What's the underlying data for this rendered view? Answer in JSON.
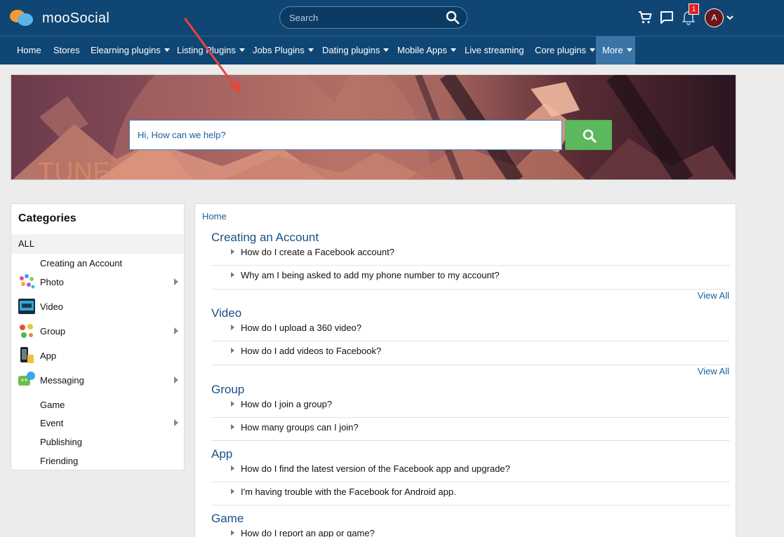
{
  "header": {
    "brand": "mooSocial",
    "search_placeholder": "Search",
    "notification_count": "1",
    "avatar_initial": "A"
  },
  "nav": {
    "items": [
      {
        "label": "Home",
        "has_dropdown": false
      },
      {
        "label": "Stores",
        "has_dropdown": false
      },
      {
        "label": "Elearning plugins",
        "has_dropdown": true
      },
      {
        "label": "Listing Plugins",
        "has_dropdown": true
      },
      {
        "label": "Jobs Plugins",
        "has_dropdown": true
      },
      {
        "label": "Dating plugins",
        "has_dropdown": true
      },
      {
        "label": "Mobile Apps",
        "has_dropdown": true
      },
      {
        "label": "Live streaming",
        "has_dropdown": false
      },
      {
        "label": "Core plugins",
        "has_dropdown": true
      },
      {
        "label": "More",
        "has_dropdown": true,
        "active": true
      }
    ]
  },
  "hero": {
    "search_placeholder": "Hi, How can we help?",
    "banner_text": "TUNE"
  },
  "sidebar": {
    "title": "Categories",
    "all_label": "ALL",
    "items": [
      {
        "label": "Creating an Account",
        "icon": "",
        "has_children": false
      },
      {
        "label": "Photo",
        "icon": "photo-icon",
        "has_children": true
      },
      {
        "label": "Video",
        "icon": "video-icon",
        "has_children": false
      },
      {
        "label": "Group",
        "icon": "group-icon",
        "has_children": true
      },
      {
        "label": "App",
        "icon": "app-icon",
        "has_children": false
      },
      {
        "label": "Messaging",
        "icon": "messaging-icon",
        "has_children": true
      },
      {
        "label": "Game",
        "icon": "",
        "has_children": false
      },
      {
        "label": "Event",
        "icon": "",
        "has_children": true
      },
      {
        "label": "Publishing",
        "icon": "",
        "has_children": false
      },
      {
        "label": "Friending",
        "icon": "",
        "has_children": false
      }
    ]
  },
  "main": {
    "breadcrumb": "Home",
    "view_all_label": "View All",
    "sections": [
      {
        "title": "Creating an Account",
        "questions": [
          "How do I create a Facebook account?",
          "Why am I being asked to add my phone number to my account?"
        ],
        "view_all": true
      },
      {
        "title": "Video",
        "questions": [
          "How do I upload a 360 video?",
          "How do I add videos to Facebook?"
        ],
        "view_all": true
      },
      {
        "title": "Group",
        "questions": [
          "How do I join a group?",
          "How many groups can I join?"
        ],
        "view_all": false
      },
      {
        "title": "App",
        "questions": [
          "How do I find the latest version of the Facebook app and upgrade?",
          "I'm having trouble with the Facebook for Android app."
        ],
        "view_all": false
      },
      {
        "title": "Game",
        "questions": [
          "How do I report an app or game?"
        ],
        "view_all": false
      }
    ]
  },
  "colors": {
    "header_bg": "#0f4674",
    "accent_link": "#1a5e9c",
    "search_button": "#5cb85c",
    "annotation_arrow": "#e8453c"
  }
}
